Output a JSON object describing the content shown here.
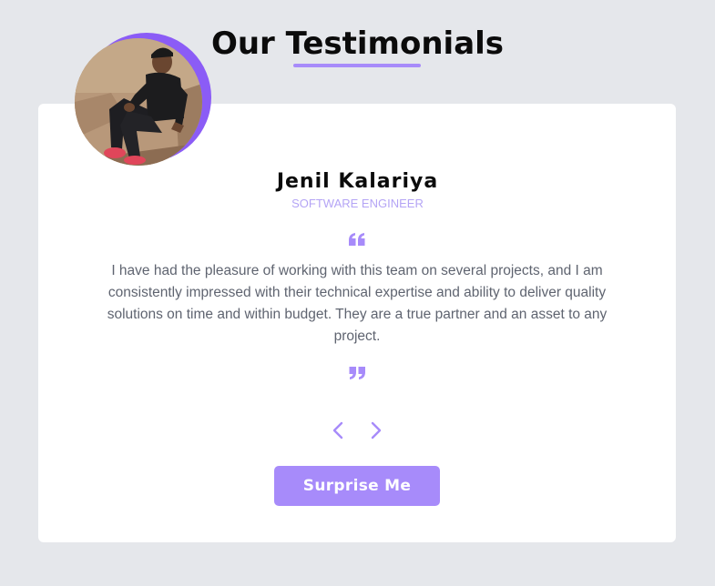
{
  "header": {
    "title": "Our Testimonials"
  },
  "testimonial": {
    "avatar_icon": "person-photo",
    "name": "Jenil Kalariya",
    "job": "SOFTWARE ENGINEER",
    "text": "I have had the pleasure of working with this team on several projects, and I am consistently impressed with their technical expertise and ability to deliver quality solutions on time and within budget. They are a true partner and an asset to any project."
  },
  "controls": {
    "prev_icon": "chevron-left-icon",
    "next_icon": "chevron-right-icon",
    "surprise_label": "Surprise Me"
  },
  "colors": {
    "background": "#e5e7eb",
    "accent": "#a78bfa",
    "accent_dark": "#8b5cf6",
    "card": "#ffffff",
    "text": "#5f6470",
    "job": "#b4a4f5"
  }
}
